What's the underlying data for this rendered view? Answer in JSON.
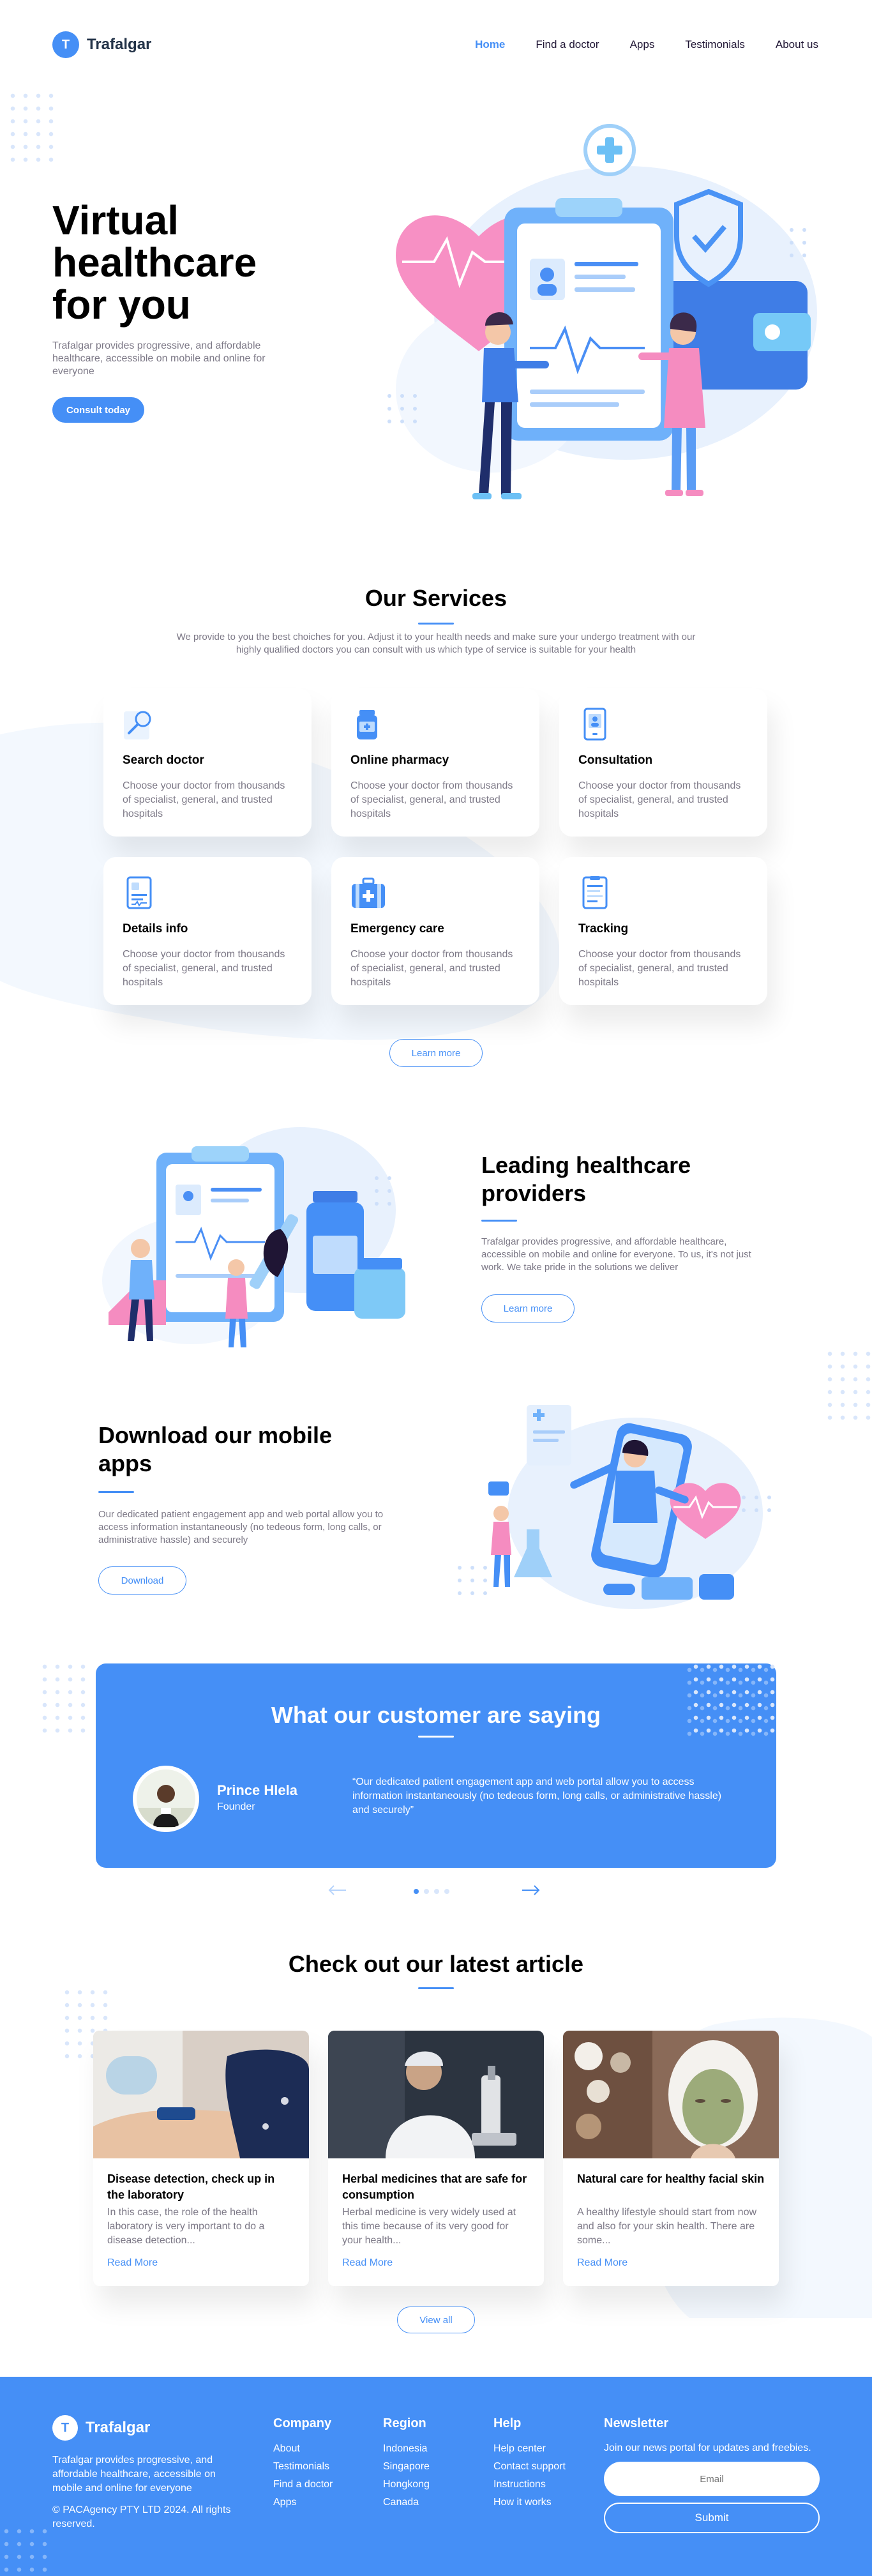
{
  "header": {
    "logo_letter": "T",
    "brand": "Trafalgar",
    "nav": [
      {
        "label": "Home",
        "active": true
      },
      {
        "label": "Find a doctor",
        "active": false
      },
      {
        "label": "Apps",
        "active": false
      },
      {
        "label": "Testimonials",
        "active": false
      },
      {
        "label": "About us",
        "active": false
      }
    ]
  },
  "hero": {
    "title_line1": "Virtual",
    "title_line2": "healthcare",
    "title_line3": "for you",
    "description": "Trafalgar provides progressive, and affordable healthcare, accessible on mobile and online for everyone",
    "cta": "Consult today"
  },
  "services": {
    "title": "Our Services",
    "description": "We provide to you the best choiches for you. Adjust it to your health needs and make sure your undergo treatment with our highly qualified doctors you can consult with us which type of service is suitable for your health",
    "items": [
      {
        "title": "Search doctor",
        "desc": "Choose your doctor from thousands of specialist, general, and trusted hospitals",
        "icon": "search-icon"
      },
      {
        "title": "Online pharmacy",
        "desc": "Choose your doctor from thousands of specialist, general, and trusted hospitals",
        "icon": "pharmacy-icon"
      },
      {
        "title": "Consultation",
        "desc": "Choose your doctor from thousands of specialist, general, and trusted hospitals",
        "icon": "consultation-icon"
      },
      {
        "title": "Details info",
        "desc": "Choose your doctor from thousands of specialist, general, and trusted hospitals",
        "icon": "details-icon"
      },
      {
        "title": "Emergency care",
        "desc": "Choose your doctor from thousands of specialist, general, and trusted hospitals",
        "icon": "emergency-icon"
      },
      {
        "title": "Tracking",
        "desc": "Choose your doctor from thousands of specialist, general, and trusted hospitals",
        "icon": "tracking-icon"
      }
    ],
    "button": "Learn more"
  },
  "providers": {
    "title_line1": "Leading healthcare",
    "title_line2": "providers",
    "description": "Trafalgar provides progressive, and affordable healthcare, accessible on mobile and online for everyone. To us, it's not just work. We take pride in the solutions we deliver",
    "button": "Learn more"
  },
  "app": {
    "title_line1": "Download our mobile",
    "title_line2": "apps",
    "description": "Our dedicated patient engagement app and web portal allow you to access information instantaneously (no tedeous form, long calls, or administrative hassle) and securely",
    "button": "Download"
  },
  "testimonials": {
    "title": "What our customer are saying",
    "name": "Prince Hlela",
    "role": "Founder",
    "quote": "“Our dedicated patient engagement app and web portal allow you to access information instantaneously (no tedeous form, long calls, or administrative hassle) and securely”",
    "dots": [
      true,
      false,
      false,
      false
    ]
  },
  "articles": {
    "title": "Check out our latest article",
    "items": [
      {
        "title": "Disease detection, check up in the laboratory",
        "desc": "In this case, the role of the health laboratory is very important to do a disease detection...",
        "link": "Read More"
      },
      {
        "title": "Herbal medicines that are safe for consumption",
        "desc": "Herbal medicine is very widely used at this time because of its very good for your health...",
        "link": "Read More"
      },
      {
        "title": "Natural care for healthy facial skin",
        "desc": "A healthy lifestyle should start from now and also for your skin health. There are some...",
        "link": "Read More"
      }
    ],
    "button": "View all"
  },
  "footer": {
    "logo_letter": "T",
    "brand": "Trafalgar",
    "description": "Trafalgar provides progressive, and affordable healthcare, accessible on mobile and online for everyone",
    "copyright": "© PACAgency PTY LTD 2024. All rights reserved.",
    "columns": [
      {
        "title": "Company",
        "links": [
          "About",
          "Testimonials",
          "Find a doctor",
          "Apps"
        ]
      },
      {
        "title": "Region",
        "links": [
          "Indonesia",
          "Singapore",
          "Hongkong",
          "Canada"
        ]
      },
      {
        "title": "Help",
        "links": [
          "Help center",
          "Contact support",
          "Instructions",
          "How it works"
        ]
      }
    ],
    "newsletter": {
      "title": "Newsletter",
      "text": "Join our news portal for updates and freebies.",
      "placeholder": "Email",
      "button": "Submit"
    }
  },
  "colors": {
    "primary": "#458ff6",
    "dark": "#1f1534",
    "muted": "#7d7987"
  }
}
